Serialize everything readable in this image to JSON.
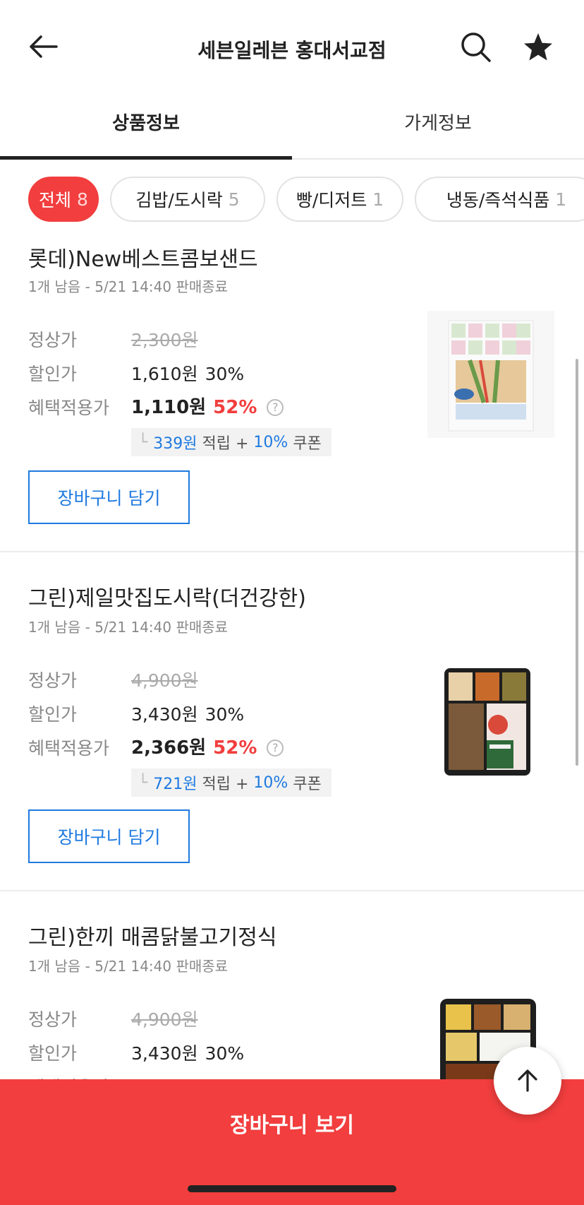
{
  "header": {
    "title": "세븐일레븐 홍대서교점",
    "back_icon": "arrow-left-icon",
    "search_icon": "search-icon",
    "favorite_icon": "star-icon"
  },
  "tabs": [
    {
      "label": "상품정보",
      "active": true
    },
    {
      "label": "가게정보",
      "active": false
    }
  ],
  "categories": [
    {
      "label": "전체",
      "count": "8",
      "active": true
    },
    {
      "label": "김밥/도시락",
      "count": "5",
      "active": false
    },
    {
      "label": "빵/디저트",
      "count": "1",
      "active": false
    },
    {
      "label": "냉동/즉석식품",
      "count": "1",
      "active": false
    }
  ],
  "labels": {
    "regular": "정상가",
    "discount": "할인가",
    "benefit": "혜택적용가",
    "add_to_cart": "장바구니 담기",
    "points_suffix": "적립 +",
    "coupon_suffix": "쿠폰"
  },
  "products": [
    {
      "name": "롯데)New베스트콤보샌드",
      "meta": "1개 남음 - 5/21 14:40 판매종료",
      "regular_price": "2,300원",
      "discount_price": "1,610원",
      "discount_pct": "30%",
      "benefit_price": "1,110원",
      "benefit_pct": "52%",
      "points": "339원",
      "coupon_pct": "10%"
    },
    {
      "name": "그린)제일맛집도시락(더건강한)",
      "meta": "1개 남음 - 5/21 14:40 판매종료",
      "regular_price": "4,900원",
      "discount_price": "3,430원",
      "discount_pct": "30%",
      "benefit_price": "2,366원",
      "benefit_pct": "52%",
      "points": "721원",
      "coupon_pct": "10%"
    },
    {
      "name": "그린)한끼 매콤닭불고기정식",
      "meta": "1개 남음 - 5/21 14:40 판매종료",
      "regular_price": "4,900원",
      "discount_price": "3,430원",
      "discount_pct": "30%"
    }
  ],
  "bottom_bar": {
    "label": "장바구니 보기"
  },
  "scroll_top_icon": "arrow-up-icon",
  "colors": {
    "accent_red": "#f23e3e",
    "link_blue": "#1f7ae0"
  }
}
